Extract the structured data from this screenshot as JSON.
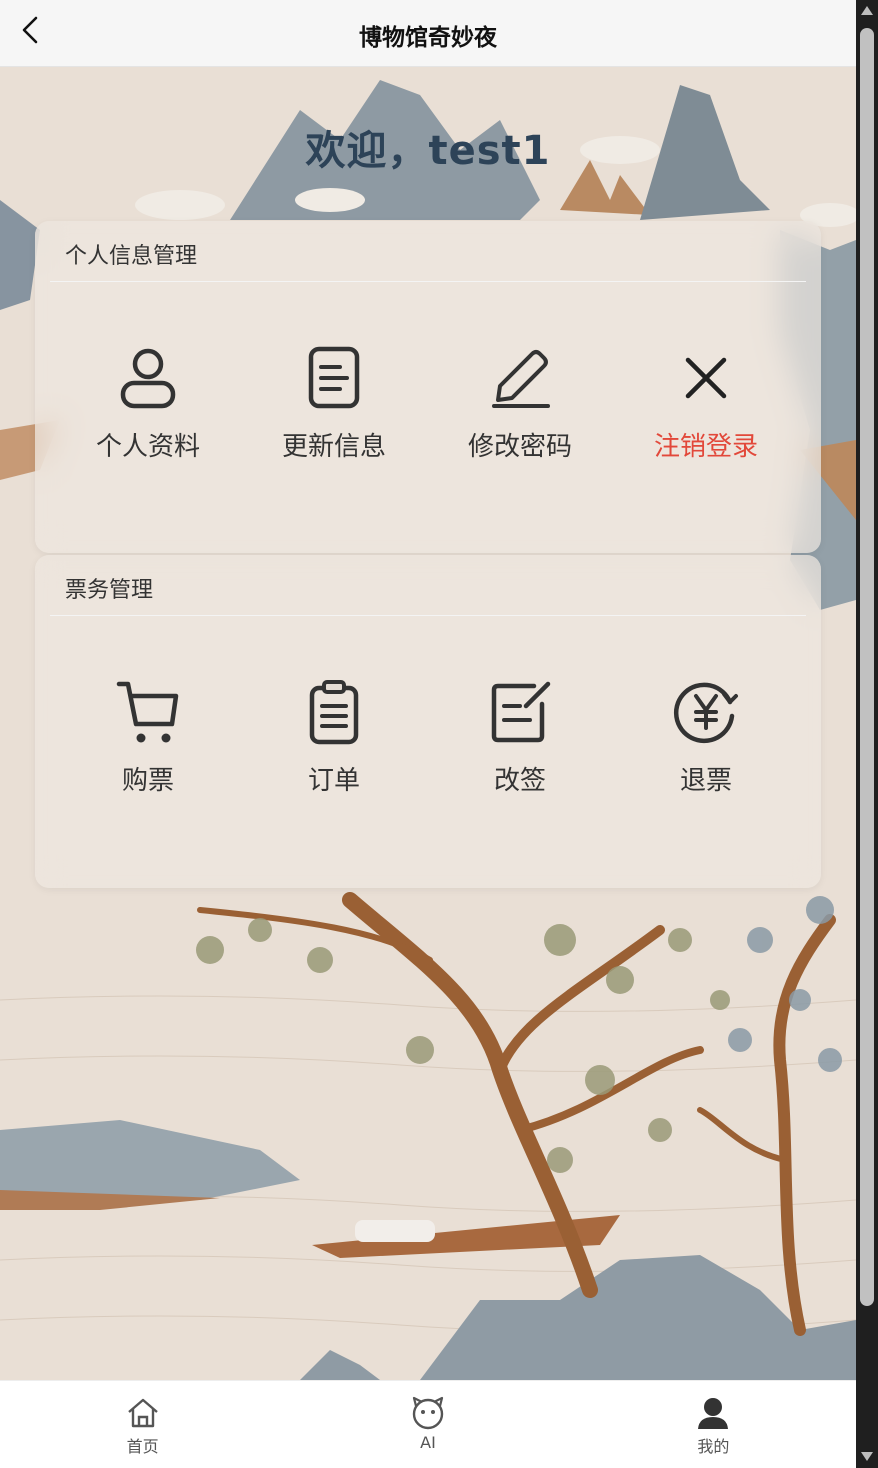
{
  "header": {
    "title": "博物馆奇妙夜",
    "back_icon": "chevron-left-icon"
  },
  "welcome_text": "欢迎，test1",
  "personal_section": {
    "title": "个人信息管理",
    "items": [
      {
        "label": "个人资料",
        "icon": "user-icon"
      },
      {
        "label": "更新信息",
        "icon": "document-icon"
      },
      {
        "label": "修改密码",
        "icon": "pencil-icon"
      },
      {
        "label": "注销登录",
        "icon": "close-icon",
        "color": "#e2483a"
      }
    ]
  },
  "ticket_section": {
    "title": "票务管理",
    "items": [
      {
        "label": "购票",
        "icon": "cart-icon"
      },
      {
        "label": "订单",
        "icon": "clipboard-icon"
      },
      {
        "label": "改签",
        "icon": "edit-icon"
      },
      {
        "label": "退票",
        "icon": "yen-refund-icon"
      }
    ]
  },
  "tabbar": {
    "items": [
      {
        "label": "首页",
        "icon": "home-icon"
      },
      {
        "label": "AI",
        "icon": "ai-face-icon"
      },
      {
        "label": "我的",
        "icon": "person-icon",
        "active": true
      }
    ]
  },
  "colors": {
    "title_blue": "#2d4358",
    "danger": "#e2483a",
    "background": "#e8ddd3"
  }
}
